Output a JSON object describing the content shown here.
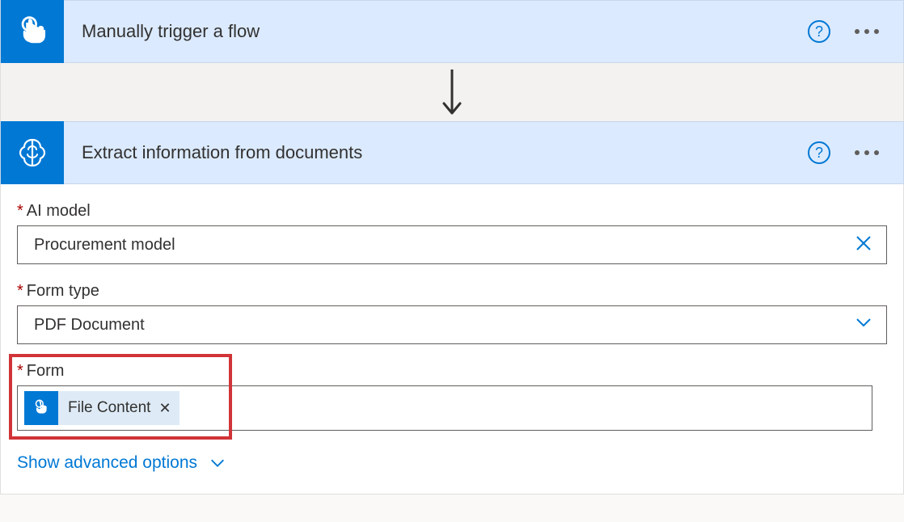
{
  "trigger": {
    "title": "Manually trigger a flow",
    "icon": "touch-icon",
    "iconBg": "#0078d4"
  },
  "action": {
    "title": "Extract information from documents",
    "icon": "brain-icon",
    "iconBg": "#0078d4",
    "fields": {
      "aiModel": {
        "label": "AI model",
        "required": true,
        "value": "Procurement model"
      },
      "formType": {
        "label": "Form type",
        "required": true,
        "value": "PDF Document"
      },
      "form": {
        "label": "Form",
        "required": true,
        "token": "File Content",
        "tokenIcon": "touch-icon"
      }
    },
    "advancedOptions": "Show advanced options"
  }
}
